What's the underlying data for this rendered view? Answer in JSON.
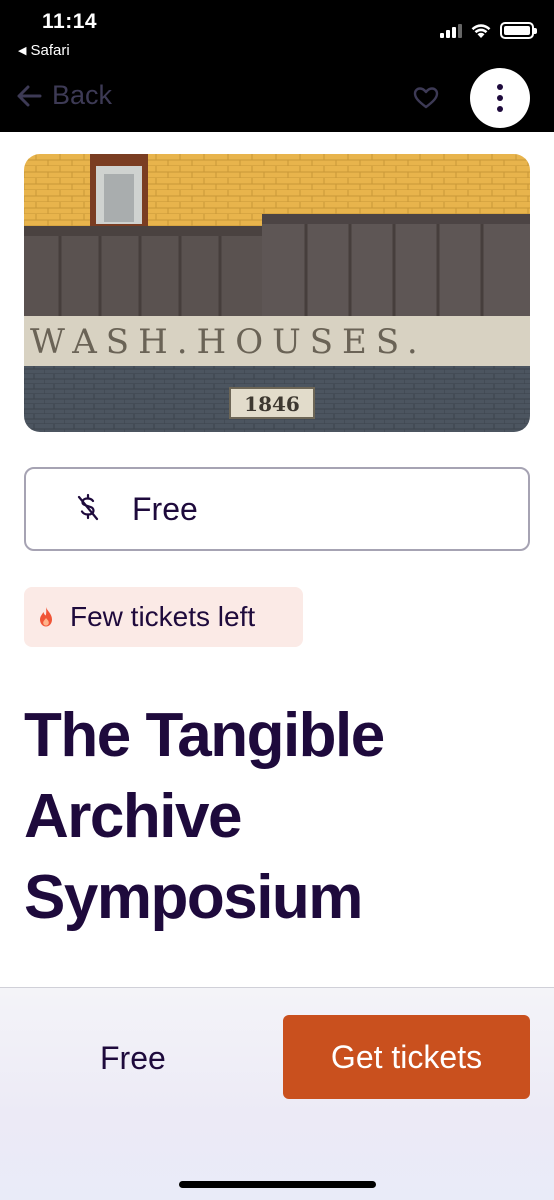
{
  "status_bar": {
    "time": "11:14",
    "back_app_label": "Safari"
  },
  "nav": {
    "back_label": "Back",
    "icons": [
      "arrow-left-icon",
      "heart-icon",
      "more-vertical-icon"
    ]
  },
  "hero": {
    "sign_text": "WASH.HOUSES.",
    "plaque_text": "1846"
  },
  "price": {
    "label": "Free",
    "icon": "no-dollar-icon"
  },
  "urgency": {
    "label": "Few tickets left",
    "icon": "flame-icon"
  },
  "event": {
    "title": "The Tangible Archive Symposium"
  },
  "footer": {
    "price": "Free",
    "cta_label": "Get tickets"
  },
  "colors": {
    "brand_text": "#1e0a3c",
    "cta": "#c9501e",
    "urgency_bg": "#fbeae6"
  }
}
